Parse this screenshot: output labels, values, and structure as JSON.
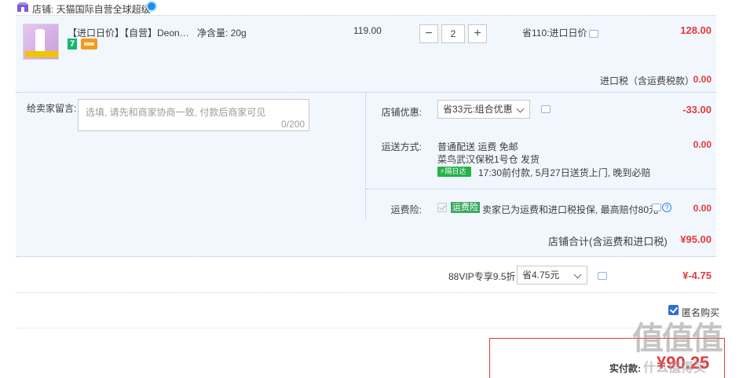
{
  "shop": {
    "name": "店铺: 天猫国际自营全球超级"
  },
  "product": {
    "title": "【进口日价】【自营】Deonat...",
    "badge": "7",
    "net_content": "净含量: 20g",
    "unit_price": "119.00",
    "quantity": "2",
    "qty_minus": "−",
    "qty_plus": "+",
    "saving": "省110:进口日价",
    "total": "128.00"
  },
  "tax": {
    "label": "进口税（含运费税款）",
    "value": "0.00"
  },
  "message": {
    "label": "给卖家留言:",
    "placeholder": "选填, 请先和商家协商一致, 付款后商家可见",
    "count": "0/200"
  },
  "shop_discount": {
    "label": "店铺优惠:",
    "selected": "省33元:组合优惠",
    "value": "-33.00"
  },
  "shipping": {
    "label": "运送方式:",
    "line1": "普通配送 运费 免邮",
    "line2": "菜鸟武汉保税1号仓  发货",
    "badge": "⚡隔日达",
    "line3": "17:30前付款, 5月27日送货上门, 晚到必赔",
    "value": "0.00"
  },
  "insurance": {
    "label": "运费险:",
    "badge": "运费险",
    "text": "卖家已为运费和进口税投保, 最高赔付80元",
    "help": "?",
    "value": "0.00"
  },
  "shop_total": {
    "label": "店铺合计(含运费和进口税)",
    "value": "¥95.00"
  },
  "vip": {
    "label": "88VIP专享9.5折",
    "selected": "省4.75元",
    "value": "¥-4.75"
  },
  "anonymous": {
    "label": "匿名购买",
    "checked": true
  },
  "payment": {
    "label": "实付款:",
    "value": "¥90.25"
  },
  "watermark": {
    "glyphs": "值值值",
    "url": "什么值得买"
  },
  "colors": {
    "accent_red": "#e4393c",
    "panel_blue": "#f2f7fe",
    "green_badge": "#26b24a"
  }
}
